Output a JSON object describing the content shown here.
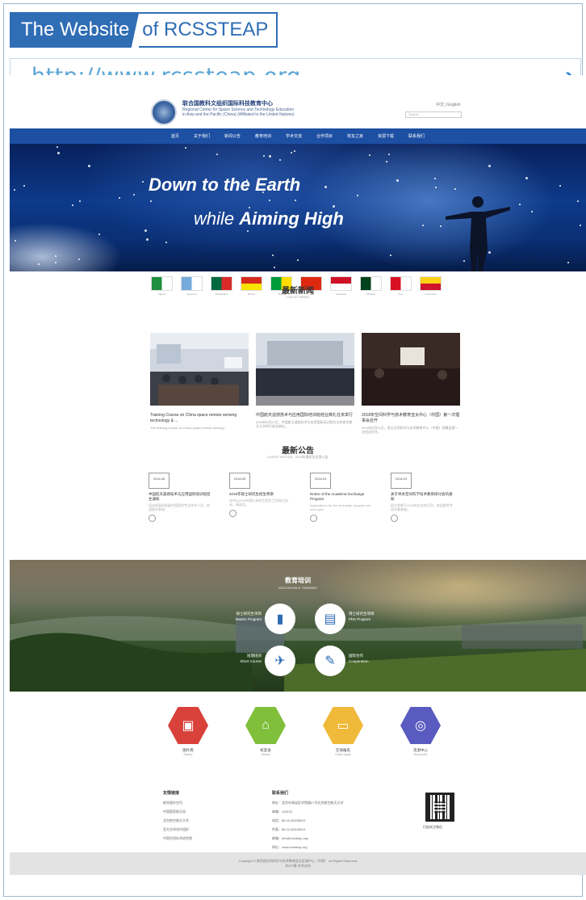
{
  "banner": {
    "title_part1": "The Website",
    "title_part2": "of RCSSTEAP",
    "url": "http://www.rcssteap.org",
    "arrow_icon": "arrow-right-icon"
  },
  "site": {
    "logo_cn": "联合国教科文组织国际科技教育中心",
    "logo_en_line1": "Regional Center for Space Science and Technology Education",
    "logo_en_line2": "in Asia and the Pacific (China) (Affiliated to the United Nations)",
    "lang": "中文 | English",
    "search_placeholder": "Search",
    "nav": [
      "首页",
      "关于我们",
      "新闻公告",
      "教育培训",
      "学术交流",
      "合作项目",
      "校友之家",
      "资源下载",
      "联系我们"
    ],
    "hero": {
      "line1": "Down to the Earth",
      "line2_prefix": "while",
      "line2_bold": "Aiming High"
    },
    "flags": [
      {
        "label": "Algeria",
        "colors": [
          "#1e8f3e",
          "#ffffff"
        ]
      },
      {
        "label": "Argentina",
        "colors": [
          "#75aadb",
          "#ffffff"
        ]
      },
      {
        "label": "Bangladesh",
        "colors": [
          "#00693e",
          "#d92a2a"
        ]
      },
      {
        "label": "Bolivia",
        "colors": [
          "#d52b1e",
          "#f9e300"
        ]
      },
      {
        "label": "Brazil",
        "colors": [
          "#009b3a",
          "#fedf00"
        ]
      },
      {
        "label": "China",
        "colors": [
          "#de2910",
          "#ffde00"
        ]
      },
      {
        "label": "Indonesia",
        "colors": [
          "#ce1126",
          "#ffffff"
        ]
      },
      {
        "label": "Pakistan",
        "colors": [
          "#01411c",
          "#ffffff"
        ]
      },
      {
        "label": "Peru",
        "colors": [
          "#d91023",
          "#ffffff"
        ]
      },
      {
        "label": "Venezuela",
        "colors": [
          "#fcd116",
          "#cf142b"
        ]
      }
    ],
    "news": {
      "title": "最新新闻",
      "subtitle": "LATEST NEWS",
      "items": [
        {
          "title": "Training Course on China space remote sensing technology & ...",
          "desc": "The training course on China space remote sensing..."
        },
        {
          "title": "中国航天遥感技术与应用国际培训班结业典礼在京举行",
          "desc": "2018年6月22日，中国航天遥感技术与应用国际培训班在北京航空航天大学举行结业典礼。"
        },
        {
          "title": "2018年空间科学与技术教育亚太中心（中国）第一次理事会召开",
          "desc": "2018年5月24日，亚太空间科学与技术教育中心（中国）理事会第一次会议召开。"
        }
      ]
    },
    "notices": {
      "title": "最新公告",
      "subtitle": "LATEST NOTICE · 2018年度招生信息公告",
      "items": [
        {
          "date": "2018-06",
          "title": "中国航天遥感技术与应用国际培训班招生通知",
          "desc": "培训班面向发展中国家的专业技术人员，欢迎报名参加。"
        },
        {
          "date": "2018-05",
          "title": "2018年硕士研究生招生简章",
          "desc": "本中心2018年硕士研究生招生工作现已启动，请关注。"
        },
        {
          "date": "2018-04",
          "title": "Notice of the Academic Exchange Program",
          "desc": "Applications for the exchange program are now open."
        },
        {
          "date": "2018-03",
          "title": "关于举办空间科学技术教育研讨会的通知",
          "desc": "研讨会将于2018年在北京召开，欢迎各界专家学者参加。"
        }
      ]
    },
    "services": {
      "title": "教育培训",
      "subtitle": "EDUCATION & TRAINING",
      "items": [
        {
          "label": "硕士研究生项目",
          "sub": "Master Program",
          "icon": "book-icon"
        },
        {
          "label": "博士研究生项目",
          "sub": "PhD Program",
          "icon": "document-icon"
        },
        {
          "label": "短期培训",
          "sub": "Short Course",
          "icon": "paper-plane-icon"
        },
        {
          "label": "国际合作",
          "sub": "Cooperation",
          "icon": "pen-icon"
        }
      ]
    },
    "quick_links": [
      {
        "label": "图片库",
        "sub": "Gallery",
        "color": "#d8423a",
        "icon": "image-icon"
      },
      {
        "label": "校友会",
        "sub": "Alumni",
        "color": "#7fbf3a",
        "icon": "bag-icon"
      },
      {
        "label": "在线报名",
        "sub": "Online Apply",
        "color": "#f0b93a",
        "icon": "monitor-icon"
      },
      {
        "label": "资源中心",
        "sub": "Resources",
        "color": "#5a5bc0",
        "icon": "globe-icon"
      }
    ],
    "footer": {
      "col1_head": "友情链接",
      "col1_items": [
        "联合国外空司",
        "中国国家航天局",
        "北京航空航天大学",
        "亚太空间合作组织",
        "中国空间技术研究院"
      ],
      "col2_head": "联系我们",
      "col2_items": [
        "地址：北京市海淀区学院路37号北京航空航天大学",
        "邮编：100191",
        "电话：86-10-82338019",
        "传真：86-10-82338019",
        "邮箱：info@rcssteap.org",
        "网址：www.rcssteap.org"
      ],
      "qr_label": "扫描关注微信"
    },
    "copyright_line1": "Copyright © 联合国空间科学与技术教育亚太区域中心（中国） All Rights Reserved",
    "copyright_line2": "京ICP备 技术支持"
  }
}
